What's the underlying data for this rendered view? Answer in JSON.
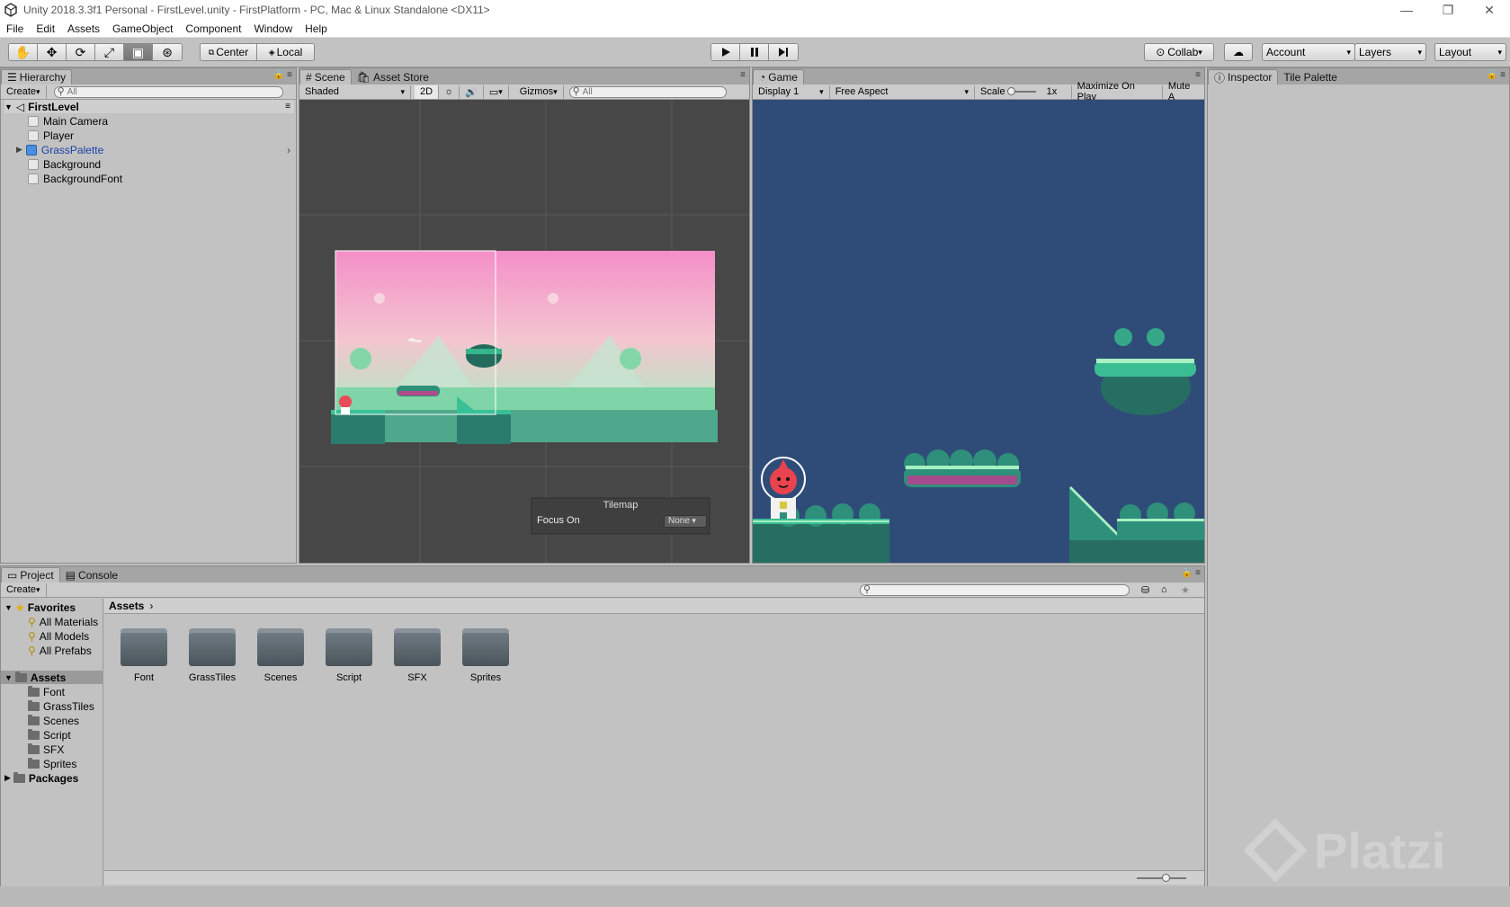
{
  "window": {
    "title": "Unity 2018.3.3f1 Personal - FirstLevel.unity - FirstPlatform - PC, Mac & Linux Standalone <DX11>",
    "controls": [
      "—",
      "❐",
      "✕"
    ]
  },
  "menu": [
    "File",
    "Edit",
    "Assets",
    "GameObject",
    "Component",
    "Window",
    "Help"
  ],
  "toolbar": {
    "tools": [
      "hand-icon",
      "move-icon",
      "rotate-icon",
      "scale-icon",
      "rect-icon",
      "transform-icon"
    ],
    "pivot": "Center",
    "space": "Local",
    "collab": "Collab",
    "account": "Account",
    "layers": "Layers",
    "layout": "Layout"
  },
  "hierarchy": {
    "tab": "Hierarchy",
    "create": "Create",
    "search_placeholder": "All",
    "scene": "FirstLevel",
    "items": [
      "Main Camera",
      "Player",
      "GrassPalette",
      "Background",
      "BackgroundFont"
    ]
  },
  "scene": {
    "tabs": [
      "Scene",
      "Asset Store"
    ],
    "shading": "Shaded",
    "mode_2d": "2D",
    "gizmos": "Gizmos",
    "search_placeholder": "All",
    "tilemap_overlay": {
      "title": "Tilemap",
      "label": "Focus On",
      "value": "None"
    }
  },
  "game": {
    "tab": "Game",
    "display": "Display 1",
    "aspect": "Free Aspect",
    "scale_label": "Scale",
    "scale_value": "1x",
    "maximize": "Maximize On Play",
    "mute": "Mute A"
  },
  "inspector": {
    "tabs": [
      "Inspector",
      "Tile Palette"
    ]
  },
  "project": {
    "tabs": [
      "Project",
      "Console"
    ],
    "create": "Create",
    "favorites": {
      "label": "Favorites",
      "items": [
        "All Materials",
        "All Models",
        "All Prefabs"
      ]
    },
    "assets": {
      "label": "Assets",
      "items": [
        "Font",
        "GrassTiles",
        "Scenes",
        "Script",
        "SFX",
        "Sprites"
      ]
    },
    "packages": "Packages",
    "breadcrumb": "Assets",
    "folders": [
      "Font",
      "GrassTiles",
      "Scenes",
      "Script",
      "SFX",
      "Sprites"
    ]
  },
  "watermark": "Platzi",
  "colors": {
    "game_bg": "#2f4c78",
    "scene_bg": "#474747",
    "sky_top": "#f48fc8",
    "sky_bottom": "#a8e8c0",
    "grass": "#2fa47e",
    "ground": "#24695e"
  }
}
